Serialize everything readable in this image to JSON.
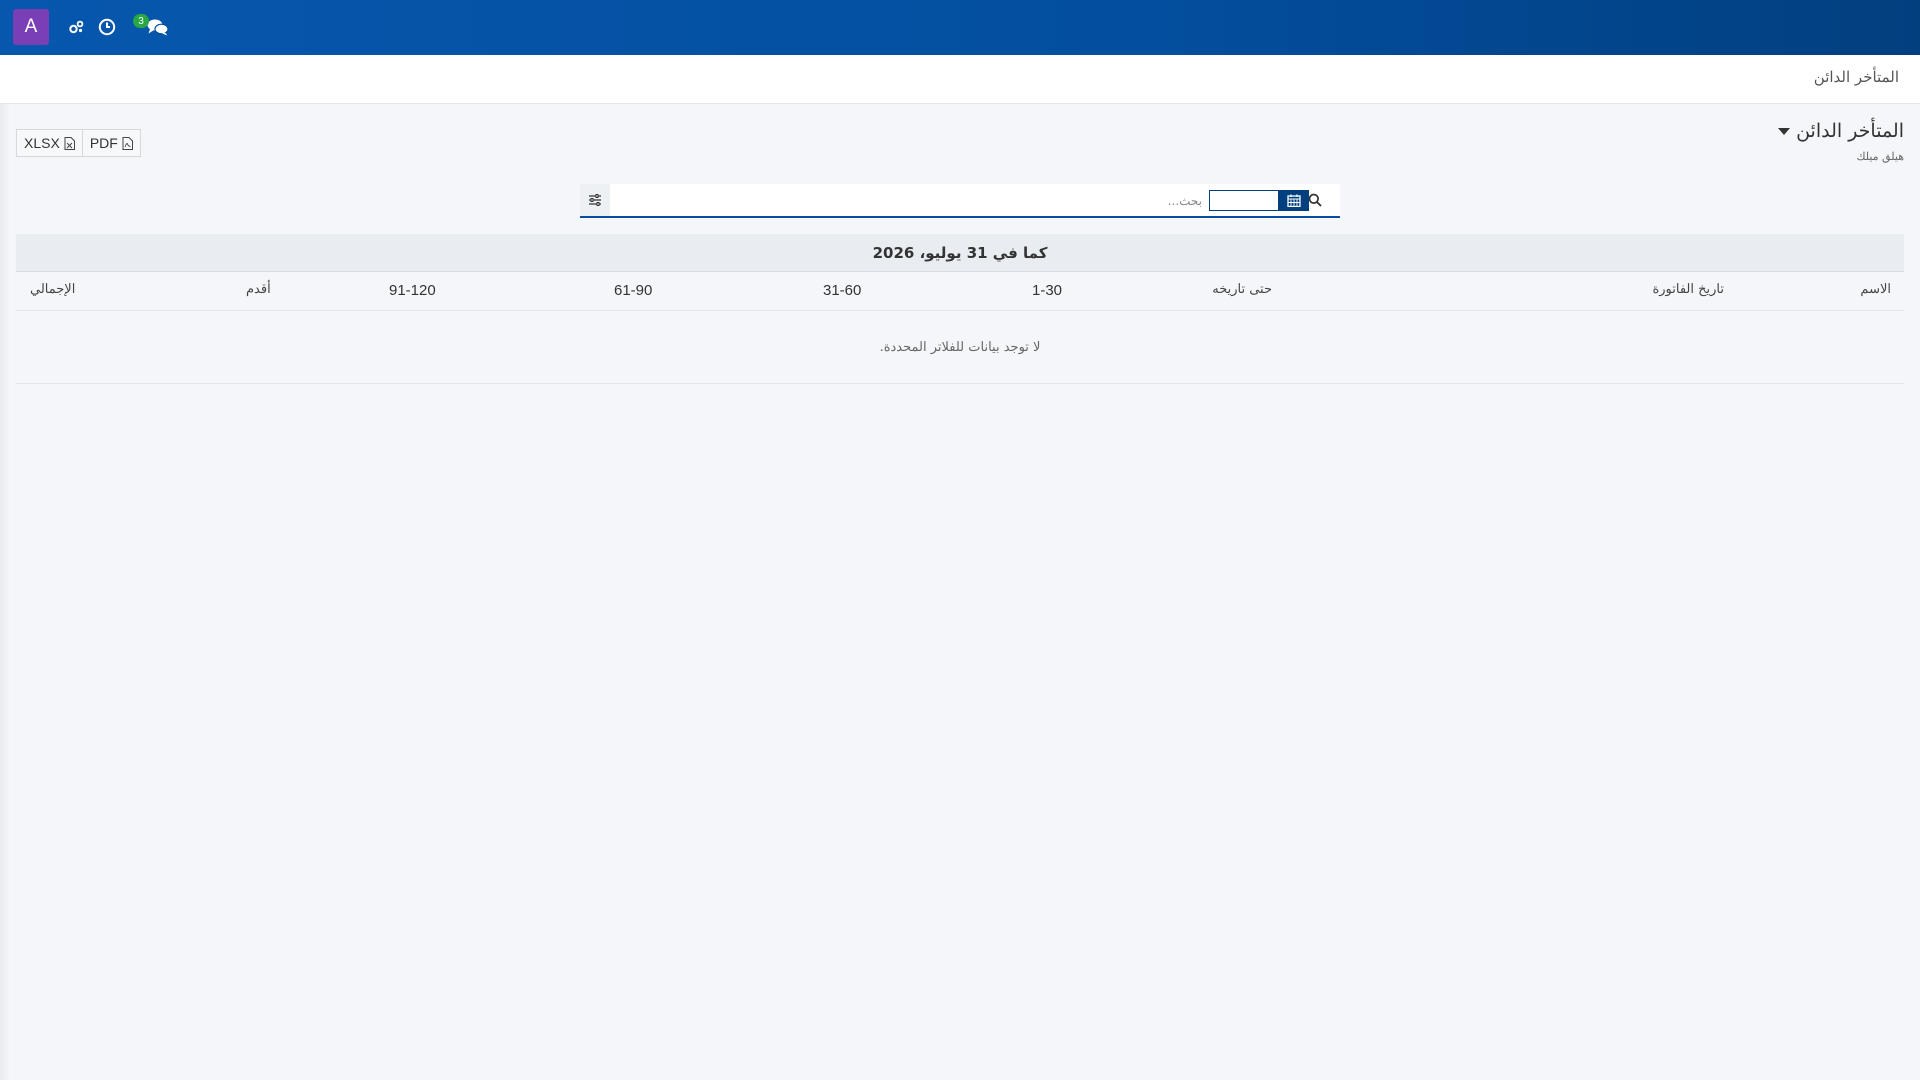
{
  "navbar": {
    "avatar_letter": "A",
    "avatar_color": "#7b3fb5",
    "bar_color": "#034e9e",
    "icons": [
      "settings-gears-icon",
      "clock-icon",
      "chat-icon"
    ],
    "chat_badge": "3",
    "badge_color": "#28a745"
  },
  "breadcrumb": {
    "label": "المتأخر الدائن"
  },
  "header": {
    "title": "المتأخر الدائن",
    "subtitle": "هيلق ميلك"
  },
  "exports": {
    "pdf_label": "PDF",
    "xlsx_label": "XLSX"
  },
  "search": {
    "placeholder": "بحث..."
  },
  "table": {
    "as_of": "كما في 31 يوليو، 2026",
    "columns": {
      "name": "الاسم",
      "invoice_date": "تاريخ الفاتورة",
      "as_of_date": "حتى تاريخه",
      "b1_30": "1-30",
      "b31_60": "31-60",
      "b61_90": "61-90",
      "b91_120": "91-120",
      "older": "أقدم",
      "total": "الإجمالي"
    },
    "empty_message": "لا توجد بيانات للفلاتر المحددة."
  }
}
